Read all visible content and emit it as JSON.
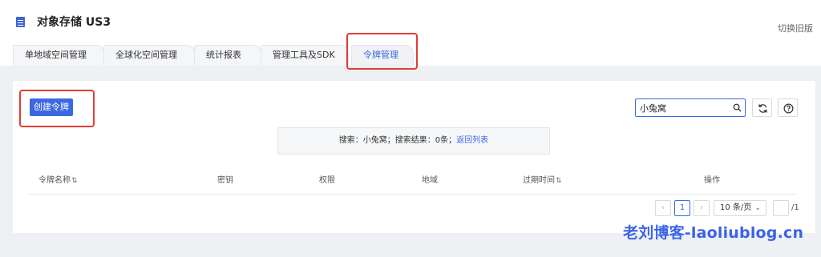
{
  "header": {
    "title": "对象存储 US3",
    "switch_old": "切换旧版"
  },
  "tabs": [
    {
      "label": "单地域空间管理"
    },
    {
      "label": "全球化空间管理"
    },
    {
      "label": "统计报表"
    },
    {
      "label": "管理工具及SDK"
    },
    {
      "label": "令牌管理",
      "active": true
    }
  ],
  "toolbar": {
    "create_label": "创建令牌",
    "search_value": "小兔窝"
  },
  "search_result": {
    "text": "搜索：小兔窝；搜索结果：0条；",
    "back_link": "返回列表"
  },
  "table": {
    "columns": [
      "令牌名称",
      "密钥",
      "权限",
      "地域",
      "过期时间",
      "操作"
    ],
    "rows": []
  },
  "pagination": {
    "current_page": "1",
    "page_size": "10 条/页",
    "total": "/1"
  },
  "watermark": "老刘博客-laoliublog.cn",
  "colors": {
    "accent": "#3c68e3",
    "highlight": "#e23b37",
    "background": "#eef0f4"
  }
}
